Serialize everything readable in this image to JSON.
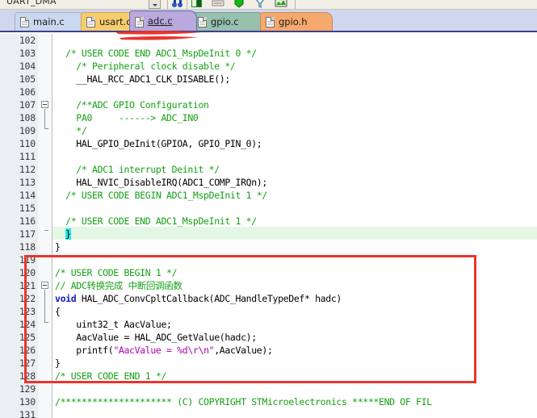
{
  "window": {
    "toolbar": {
      "combo_value": "UART_DMA",
      "combo_arrow_icon": "chevron-down-icon",
      "icons": [
        {
          "name": "binoculars-icon",
          "glyph": "\u0001"
        },
        {
          "name": "book-icon",
          "glyph": "\u0001"
        },
        {
          "name": "insert-icon",
          "glyph": "\u0001"
        },
        {
          "name": "bookmark-icon",
          "glyph": "\u0001"
        },
        {
          "name": "filter-icon",
          "glyph": "\u0001"
        },
        {
          "name": "map-icon",
          "glyph": "\u0001"
        }
      ]
    },
    "tabs": [
      {
        "label": "main.c",
        "icon": "file-icon",
        "color": "#c9d8ef",
        "active": false
      },
      {
        "label": "usart.c",
        "icon": "file-icon",
        "color": "#f7cd6c",
        "active": false
      },
      {
        "label": "adc.c",
        "icon": "file-icon",
        "color": "#b9a9dd",
        "active": true
      },
      {
        "label": "gpio.c",
        "icon": "file-icon",
        "color": "#97c0ad",
        "active": false
      },
      {
        "label": "gpio.h",
        "icon": "file-icon",
        "color": "#f6a96d",
        "active": false
      }
    ],
    "accent_colors": {
      "tabbar_background": "#cfd6ee",
      "active_tab_underline": "#3f3f8a",
      "annotation_red": "#e8352e",
      "current_line_highlight": "#e4f7e4",
      "brace_match_highlight": "#27e8e8",
      "comment_green": "#15a015",
      "keyword_blue": "#1515cc",
      "string_magenta": "#b000b0"
    }
  },
  "editor": {
    "first_line": 102,
    "active_line": 117,
    "lines": [
      {
        "n": 102,
        "fold": "none",
        "text": ""
      },
      {
        "n": 103,
        "fold": "none",
        "text": "  /* USER CODE END ADC1_MspDeInit 0 */",
        "style": "comment"
      },
      {
        "n": 104,
        "fold": "none",
        "text": "    /* Peripheral clock disable */",
        "style": "comment"
      },
      {
        "n": 105,
        "fold": "none",
        "text": "    __HAL_RCC_ADC1_CLK_DISABLE();",
        "style": "plain"
      },
      {
        "n": 106,
        "fold": "none",
        "text": ""
      },
      {
        "n": 107,
        "fold": "start",
        "text": "    /**ADC GPIO Configuration",
        "style": "comment"
      },
      {
        "n": 108,
        "fold": "bar",
        "text": "    PA0     ------> ADC_IN0",
        "style": "comment"
      },
      {
        "n": 109,
        "fold": "end",
        "text": "    */",
        "style": "comment"
      },
      {
        "n": 110,
        "fold": "none",
        "text": "    HAL_GPIO_DeInit(GPIOA, GPIO_PIN_0);",
        "style": "plain"
      },
      {
        "n": 111,
        "fold": "none",
        "text": ""
      },
      {
        "n": 112,
        "fold": "none",
        "text": "    /* ADC1 interrupt Deinit */",
        "style": "comment"
      },
      {
        "n": 113,
        "fold": "none",
        "text": "    HAL_NVIC_DisableIRQ(ADC1_COMP_IRQn);",
        "style": "plain"
      },
      {
        "n": 114,
        "fold": "none",
        "text": "  /* USER CODE BEGIN ADC1_MspDeInit 1 */",
        "style": "comment"
      },
      {
        "n": 115,
        "fold": "none",
        "text": ""
      },
      {
        "n": 116,
        "fold": "none",
        "text": "  /* USER CODE END ADC1_MspDeInit 1 */",
        "style": "comment"
      },
      {
        "n": 117,
        "fold": "endtick",
        "text": "  }",
        "style": "brace"
      },
      {
        "n": 118,
        "fold": "none",
        "text": "}",
        "style": "plain"
      },
      {
        "n": 119,
        "fold": "endtick2",
        "text": ""
      },
      {
        "n": 120,
        "fold": "none",
        "text": "/* USER CODE BEGIN 1 */",
        "style": "comment"
      },
      {
        "n": 121,
        "fold": "none",
        "text": "// ADC转换完成 中断回调函数",
        "style": "comment"
      },
      {
        "n": 122,
        "fold": "none",
        "text": "void HAL_ADC_ConvCpltCallback(ADC_HandleTypeDef* hadc)",
        "style": "decl"
      },
      {
        "n": 123,
        "fold": "start",
        "text": "{",
        "style": "plain"
      },
      {
        "n": 124,
        "fold": "bar",
        "text": "    uint32_t AacValue;",
        "style": "plain"
      },
      {
        "n": 125,
        "fold": "bar",
        "text": "    AacValue = HAL_ADC_GetValue(hadc);",
        "style": "plain"
      },
      {
        "n": 126,
        "fold": "bar",
        "text": "    printf(\"AacValue = %d\\r\\n\",AacValue);",
        "style": "printf"
      },
      {
        "n": 127,
        "fold": "end",
        "text": "}",
        "style": "plain"
      },
      {
        "n": 128,
        "fold": "none",
        "text": "/* USER CODE END 1 */",
        "style": "comment"
      },
      {
        "n": 129,
        "fold": "none",
        "text": ""
      },
      {
        "n": 130,
        "fold": "none",
        "text": "/********************* (C) COPYRIGHT STMicroelectronics *****END OF FIL",
        "style": "comment"
      },
      {
        "n": 131,
        "fold": "none",
        "text": ""
      }
    ],
    "tokens": {
      "line_122_keyword": "void",
      "line_122_rest": " HAL_ADC_ConvCpltCallback(ADC_HandleTypeDef* hadc)",
      "line_126_pre": "    printf(",
      "line_126_string": "\"AacValue = %d\\r\\n\"",
      "line_126_post": ",AacValue);"
    }
  },
  "annotations": {
    "red_box": {
      "label": "red-rectangle-highlight",
      "color": "#e8352e"
    },
    "red_scribble": {
      "label": "red-underline-scribble",
      "color": "#e8352e"
    }
  }
}
